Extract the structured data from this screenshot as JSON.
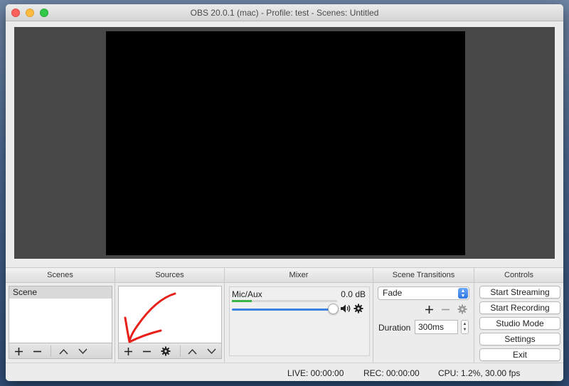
{
  "window": {
    "title": "OBS 20.0.1 (mac) - Profile: test - Scenes: Untitled"
  },
  "scenes": {
    "header": "Scenes",
    "items": [
      {
        "label": "Scene",
        "selected": true
      }
    ]
  },
  "sources": {
    "header": "Sources",
    "items": []
  },
  "mixer": {
    "header": "Mixer",
    "channels": [
      {
        "name": "Mic/Aux",
        "level": "0.0 dB",
        "volume_fraction": 1.0
      }
    ]
  },
  "scene_transitions": {
    "header": "Scene Transitions",
    "selected": "Fade",
    "duration_label": "Duration",
    "duration_value": "300ms"
  },
  "controls": {
    "header": "Controls",
    "start_streaming": "Start Streaming",
    "start_recording": "Start Recording",
    "studio_mode": "Studio Mode",
    "settings": "Settings",
    "exit": "Exit"
  },
  "status": {
    "live": "LIVE: 00:00:00",
    "rec": "REC: 00:00:00",
    "cpu": "CPU: 1.2%, 30.00 fps"
  },
  "icons": {
    "add": "plus-icon",
    "remove": "minus-icon",
    "move_up": "chevron-up-icon",
    "move_down": "chevron-down-icon",
    "properties": "gear-icon",
    "speaker": "speaker-icon"
  },
  "colors": {
    "volume_track": "#3b82e3",
    "vu_meter": "#39b54a",
    "annotation": "#e8201a"
  }
}
